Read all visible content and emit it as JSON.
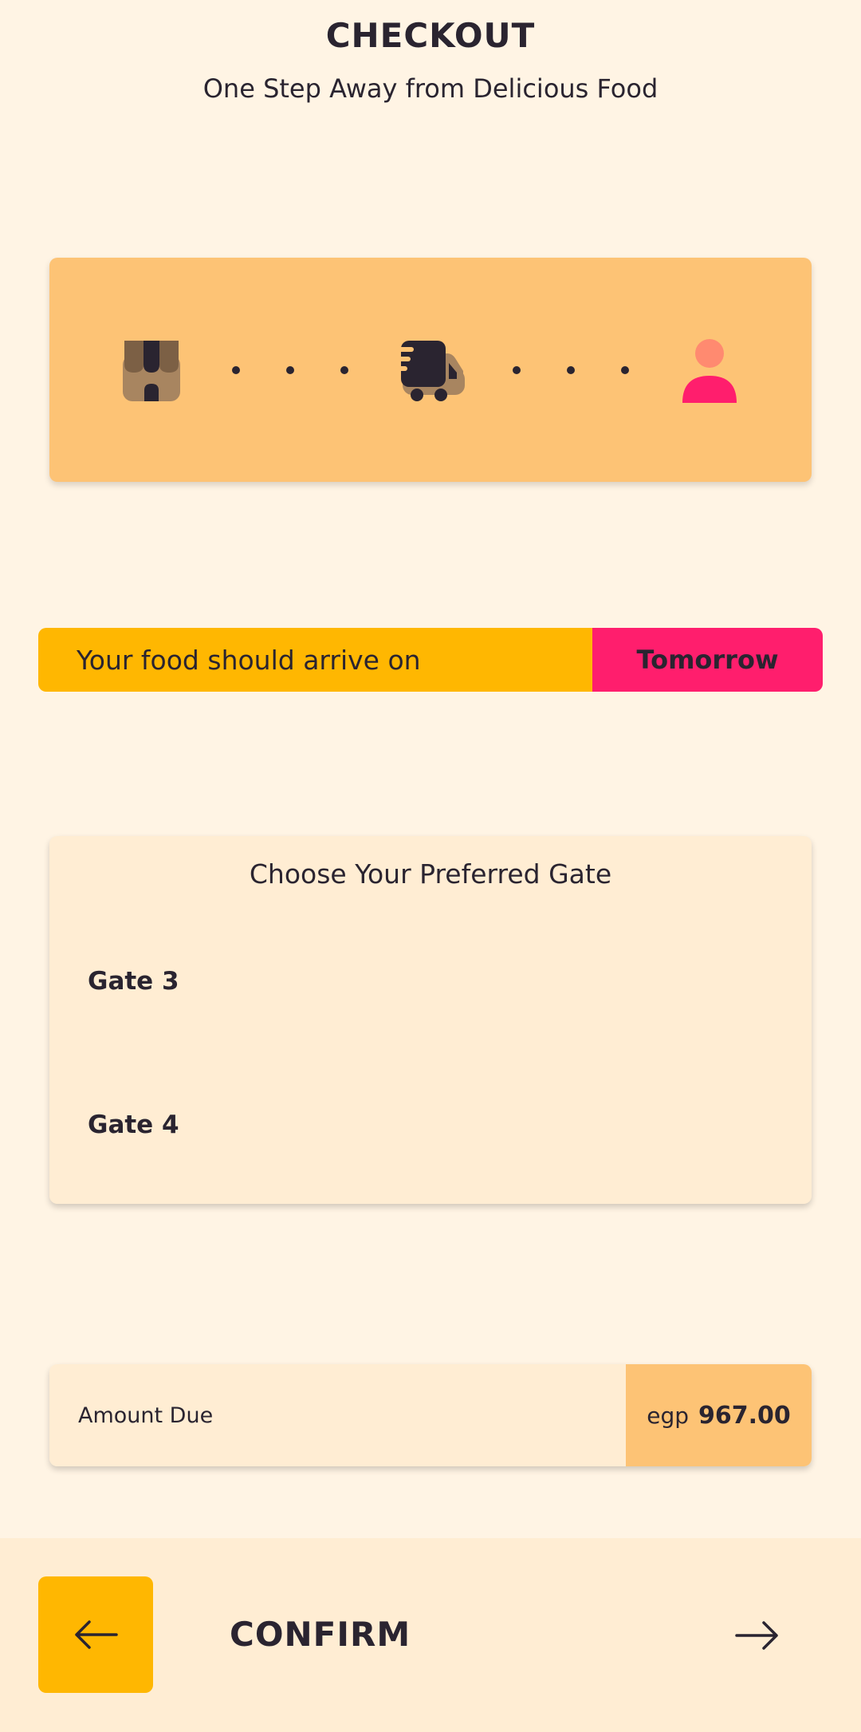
{
  "header": {
    "title": "CHECKOUT",
    "subtitle": "One Step Away from Delicious Food"
  },
  "tracker": {
    "icons": [
      "store-icon",
      "delivery-truck-icon",
      "customer-icon"
    ],
    "colors": {
      "store": "#7C6045",
      "truck": "#2A2430",
      "customer_head": "#FF8A70",
      "customer_body": "#FF1E6D"
    }
  },
  "arrival": {
    "label": "Your food should arrive on",
    "value": "Tomorrow"
  },
  "gates": {
    "heading": "Choose Your Preferred Gate",
    "options": [
      "Gate 3",
      "Gate 4"
    ]
  },
  "amount": {
    "label": "Amount Due",
    "currency": "egp",
    "value": "967.00"
  },
  "footer": {
    "confirm_label": "CONFIRM",
    "back_icon": "arrow-left-icon",
    "next_icon": "arrow-right-icon"
  },
  "colors": {
    "background": "#FFF4E4",
    "card": "#FFEDD3",
    "accent_orange": "#FDC375",
    "accent_yellow": "#FFB701",
    "accent_pink": "#FF1E6D",
    "text": "#2A2430"
  }
}
